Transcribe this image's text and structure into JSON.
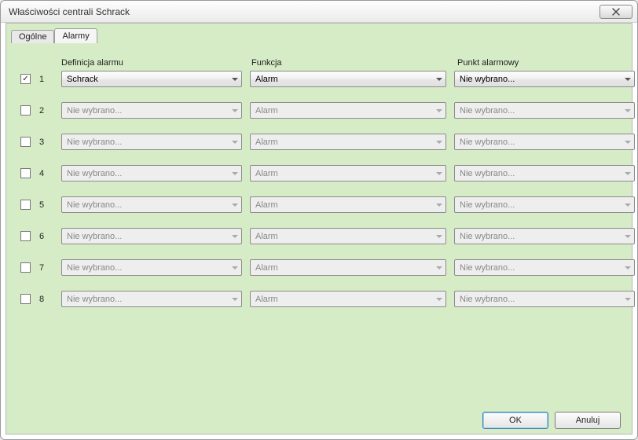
{
  "window": {
    "title": "Właściwości centrali Schrack"
  },
  "tabs": {
    "general": "Ogólne",
    "alarms": "Alarmy"
  },
  "headers": {
    "definition": "Definicja alarmu",
    "function": "Funkcja",
    "point": "Punkt alarmowy"
  },
  "buttons": {
    "ok": "OK",
    "cancel": "Anuluj"
  },
  "default_values": {
    "not_selected": "Nie wybrano...",
    "alarm": "Alarm"
  },
  "rows": [
    {
      "index": "1",
      "checked": true,
      "enabled": true,
      "definition": "Schrack",
      "function": "Alarm",
      "point": "Nie wybrano..."
    },
    {
      "index": "2",
      "checked": false,
      "enabled": false,
      "definition": "Nie wybrano...",
      "function": "Alarm",
      "point": "Nie wybrano..."
    },
    {
      "index": "3",
      "checked": false,
      "enabled": false,
      "definition": "Nie wybrano...",
      "function": "Alarm",
      "point": "Nie wybrano..."
    },
    {
      "index": "4",
      "checked": false,
      "enabled": false,
      "definition": "Nie wybrano...",
      "function": "Alarm",
      "point": "Nie wybrano..."
    },
    {
      "index": "5",
      "checked": false,
      "enabled": false,
      "definition": "Nie wybrano...",
      "function": "Alarm",
      "point": "Nie wybrano..."
    },
    {
      "index": "6",
      "checked": false,
      "enabled": false,
      "definition": "Nie wybrano...",
      "function": "Alarm",
      "point": "Nie wybrano..."
    },
    {
      "index": "7",
      "checked": false,
      "enabled": false,
      "definition": "Nie wybrano...",
      "function": "Alarm",
      "point": "Nie wybrano..."
    },
    {
      "index": "8",
      "checked": false,
      "enabled": false,
      "definition": "Nie wybrano...",
      "function": "Alarm",
      "point": "Nie wybrano..."
    }
  ]
}
